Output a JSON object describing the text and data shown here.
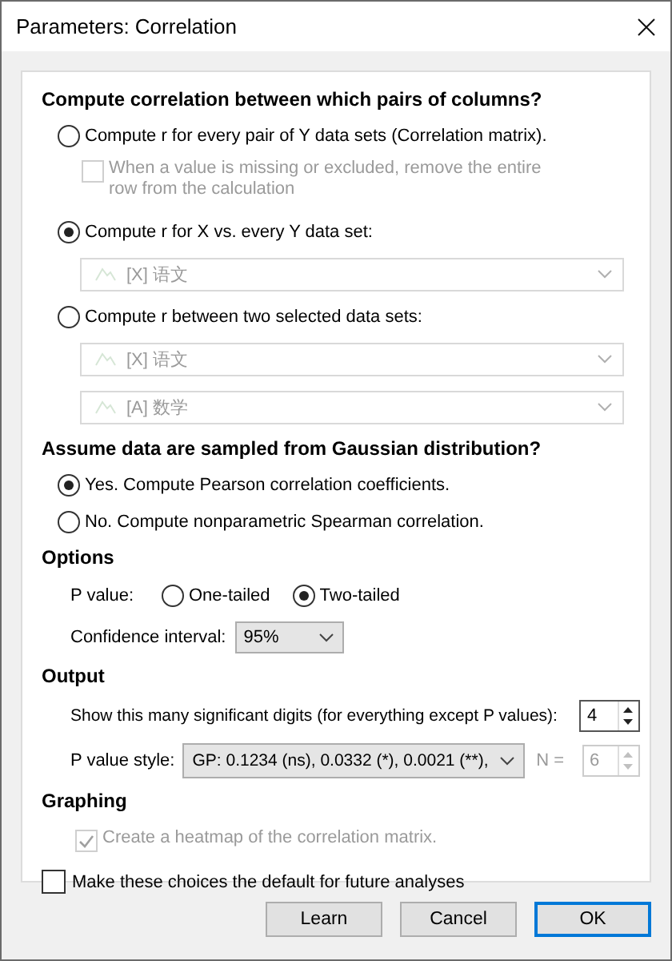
{
  "window": {
    "title": "Parameters: Correlation"
  },
  "sections": [
    {
      "heading": "Compute correlation between which pairs of columns?",
      "items": [
        {
          "kind": "radio",
          "label": "Compute r for every pair of Y data sets (Correlation matrix).",
          "selected": false
        },
        {
          "kind": "checkbox",
          "label": "When a value is missing or excluded, remove the entire row from the calculation",
          "checked": false,
          "disabled": true
        },
        {
          "kind": "radio",
          "label": "Compute r for X vs. every Y data set:",
          "selected": true
        },
        {
          "kind": "dataset",
          "value": "[X] 语文",
          "disabled": true
        },
        {
          "kind": "radio",
          "label": "Compute r between two selected data sets:",
          "selected": false
        },
        {
          "kind": "dataset",
          "value": "[X] 语文",
          "disabled": true
        },
        {
          "kind": "dataset",
          "value": "[A] 数学",
          "disabled": true
        }
      ]
    },
    {
      "heading": "Assume data are sampled from Gaussian distribution?",
      "items": [
        {
          "kind": "radio",
          "label": "Yes. Compute Pearson correlation coefficients.",
          "selected": true
        },
        {
          "kind": "radio",
          "label": "No. Compute nonparametric Spearman correlation.",
          "selected": false
        }
      ]
    },
    {
      "heading": "Options",
      "items": [
        {
          "kind": "choice",
          "label": "P value:",
          "options": [
            {
              "label": "One-tailed",
              "selected": false
            },
            {
              "label": "Two-tailed",
              "selected": true
            }
          ]
        },
        {
          "kind": "select",
          "label": "Confidence interval:",
          "value": "95%"
        }
      ]
    },
    {
      "heading": "Output",
      "items": [
        {
          "kind": "spinner",
          "label": "Show this many significant digits (for everything except P values):",
          "value": "4",
          "disabled": false
        },
        {
          "kind": "pstyle",
          "label": "P value style:",
          "value": "GP: 0.1234 (ns), 0.0332 (*), 0.0021 (**),",
          "n_label": "N =",
          "n_value": "6",
          "n_disabled": true
        }
      ]
    },
    {
      "heading": "Graphing",
      "items": [
        {
          "kind": "checkbox",
          "label": "Create a heatmap of the correlation matrix.",
          "checked": true,
          "disabled": true
        }
      ]
    }
  ],
  "default_checkbox": {
    "label": "Make these choices the default for future analyses",
    "checked": false
  },
  "buttons": [
    {
      "label": "Learn",
      "default": false
    },
    {
      "label": "Cancel",
      "default": false
    },
    {
      "label": "OK",
      "default": true
    }
  ]
}
